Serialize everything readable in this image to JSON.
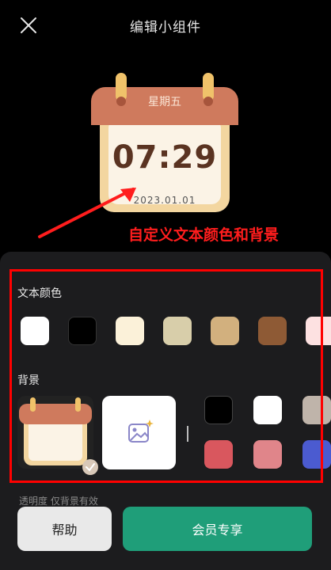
{
  "header": {
    "title": "编辑小组件",
    "close_icon": "close-icon"
  },
  "preview": {
    "weekday": "星期五",
    "time": "07:29",
    "date": "2023.01.01"
  },
  "annotation": "自定义文本颜色和背景",
  "text_color": {
    "label": "文本颜色",
    "swatches": [
      "#ffffff",
      "#000000",
      "#fbf1d9",
      "#d8ceaa",
      "#d2b07e",
      "#8e5a35",
      "#fde1e1"
    ]
  },
  "background": {
    "label": "背景",
    "upload_icon": "image-upload-icon",
    "colors_row1": [
      "#000000",
      "#ffffff",
      "#bfb4aa"
    ],
    "colors_row2": [
      "#d9575e",
      "#e0858a",
      "#4b5bd0"
    ]
  },
  "opacity_label": "透明度 仅背景有效",
  "buttons": {
    "help": "帮助",
    "vip": "会员专享"
  }
}
